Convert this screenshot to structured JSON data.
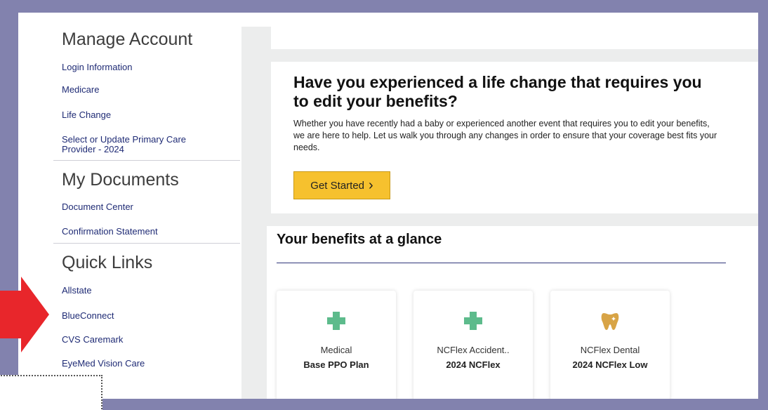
{
  "sidebar": {
    "manage_account": {
      "title": "Manage Account",
      "items": [
        "Login Information",
        "Medicare",
        "Life Change",
        "Select or Update Primary Care Provider - 2024"
      ]
    },
    "my_documents": {
      "title": "My Documents",
      "items": [
        "Document Center",
        "Confirmation Statement"
      ]
    },
    "quick_links": {
      "title": "Quick Links",
      "items": [
        "Allstate",
        "BlueConnect",
        "CVS Caremark",
        "EyeMed Vision Care"
      ]
    }
  },
  "life_change": {
    "title": "Have you experienced a life change that requires you to edit your benefits?",
    "description": "Whether you have recently had a baby or experienced another event that requires you to edit your benefits, we are here to help. Let us walk you through any changes in order to ensure that your coverage best fits your needs.",
    "button_label": "Get Started",
    "button_chevron": "›"
  },
  "benefits": {
    "title": "Your benefits at a glance",
    "cards": [
      {
        "type": "Medical",
        "plan": "Base PPO Plan",
        "icon": "plus-icon"
      },
      {
        "type": "NCFlex Accident..",
        "plan": "2024 NCFlex",
        "icon": "plus-icon"
      },
      {
        "type": "NCFlex Dental",
        "plan": "2024 NCFlex Low",
        "icon": "tooth-icon"
      }
    ]
  },
  "colors": {
    "outer_border": "#8282ae",
    "link": "#1f2b75",
    "button": "#f6c12e",
    "plus_icon": "#5dbb8c",
    "tooth_icon": "#d8a446",
    "annotation_arrow": "#e8262b"
  }
}
